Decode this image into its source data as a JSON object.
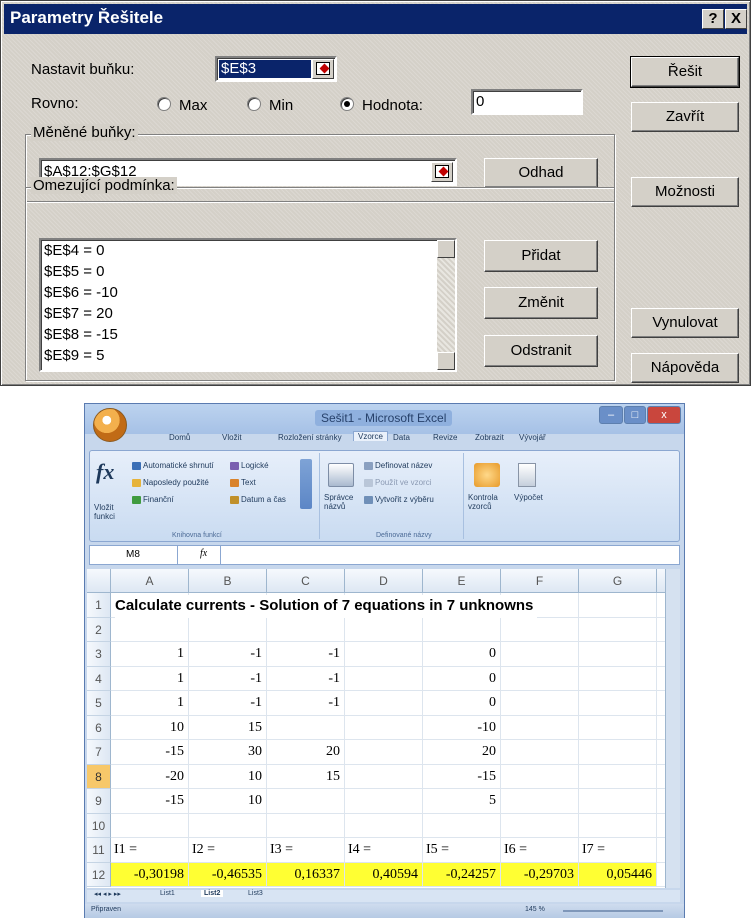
{
  "dialog": {
    "title": "Parametry Řešitele",
    "help_btn": "?",
    "close_btn": "X",
    "target_label": "Nastavit buňku:",
    "target_value": "$E$3",
    "equal_label": "Rovno:",
    "radio_max": "Max",
    "radio_min": "Min",
    "radio_value": "Hodnota:",
    "selected_radio": "value",
    "value_input": "0",
    "changing_group": "Měněné buňky:",
    "changing_value": "$A$12:$G$12",
    "guess_btn": "Odhad",
    "constraints_group": "Omezující podmínka:",
    "constraints": [
      "$E$4 = 0",
      "$E$5 = 0",
      "$E$6 = -10",
      "$E$7 = 20",
      "$E$8 = -15",
      "$E$9 = 5"
    ],
    "add_btn": "Přidat",
    "change_btn": "Změnit",
    "delete_btn": "Odstranit",
    "solve_btn": "Řešit",
    "close_btn2": "Zavřít",
    "options_btn": "Možnosti",
    "reset_btn": "Vynulovat",
    "help_btn2": "Nápověda"
  },
  "excel": {
    "window_title": "Sešit1 - Microsoft Excel",
    "ribbon_tabs": [
      "Domů",
      "Vložit",
      "Rozložení stránky",
      "Vzorce",
      "Data",
      "Revize",
      "Zobrazit",
      "Vývojář"
    ],
    "ribbon_groups": [
      "Knihovna funkcí",
      "Definované názvy"
    ],
    "ribbon_items": [
      "Vložit funkci",
      "Automatické shrnutí",
      "Naposledy použité",
      "Finanční",
      "Logické",
      "Text",
      "Datum a čas",
      "Správce názvů",
      "Definovat název",
      "Použít ve vzorci",
      "Vytvořit z výběru",
      "Kontrola vzorců",
      "Výpočet"
    ],
    "name_box": "M8",
    "fx": "fx",
    "columns": [
      "A",
      "B",
      "C",
      "D",
      "E",
      "F",
      "G"
    ],
    "rows": [
      "1",
      "2",
      "3",
      "4",
      "5",
      "6",
      "7",
      "8",
      "9",
      "10",
      "11",
      "12"
    ],
    "selected_row": "8",
    "title_text": "Calculate currents -  Solution of 7 equations in 7 unknowns",
    "table": [
      [
        "1",
        "-1",
        "-1",
        "",
        "0"
      ],
      [
        "1",
        "-1",
        "-1",
        "",
        "0"
      ],
      [
        "1",
        "-1",
        "-1",
        "",
        "0"
      ],
      [
        "10",
        "15",
        "",
        "",
        "-10"
      ],
      [
        "-15",
        "30",
        "20",
        "",
        "20"
      ],
      [
        "-20",
        "10",
        "15",
        "",
        "-15"
      ],
      [
        "-15",
        "10",
        "",
        "",
        "5"
      ]
    ],
    "unknown_labels": [
      "I1 =",
      "I2 =",
      "I3 =",
      "I4 =",
      "I5 =",
      "I6 =",
      "I7 ="
    ],
    "results": [
      "-0,30198",
      "-0,46535",
      "0,16337",
      "0,40594",
      "-0,24257",
      "-0,29703",
      "0,05446"
    ],
    "sheets": [
      "List1",
      "List2",
      "List3"
    ],
    "active_sheet": "List2",
    "status": "Připraven",
    "zoom": "145 %",
    "highlight_color": "#ffff33"
  }
}
